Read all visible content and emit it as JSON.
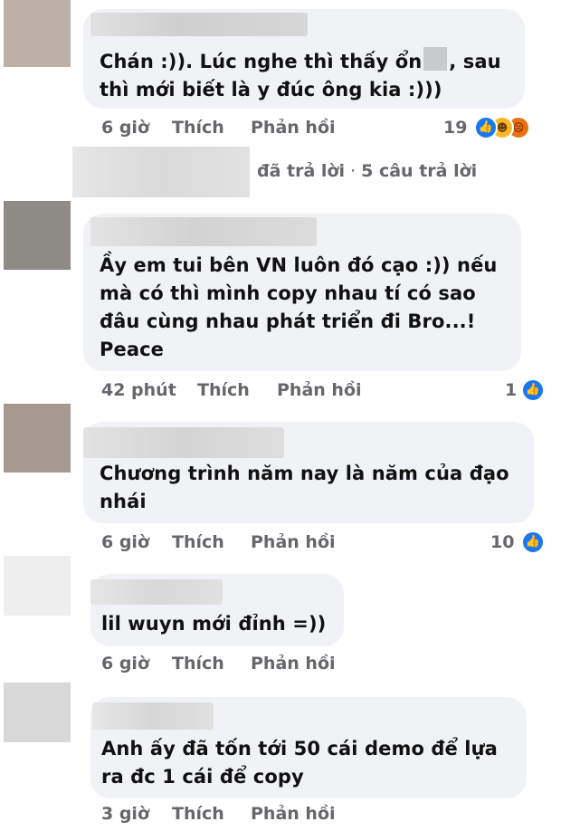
{
  "colors": {
    "bubble": "#f0f2f5",
    "meta_text": "#65676b",
    "like_blue": "#1877f2",
    "haha_yellow": "#f7b928",
    "angry_orange": "#e9710f"
  },
  "comments": [
    {
      "text_before_censor": "Chán :)). Lúc nghe thì thấy ổn",
      "text_after_censor": ", sau\nthì mới biết là y đúc ông kia :)))",
      "time": "6 giờ",
      "like": "Thích",
      "reply": "Phản hồi",
      "reaction_count": "19",
      "reaction_icons": [
        "like-icon",
        "haha-icon",
        "angry-icon"
      ]
    },
    {
      "text": "Ầy em tui bên VN luôn đó cạo :)) nếu\nmà có  thì mình copy nhau tí có sao\nđâu cùng nhau phát triển đi Bro...!\nPeace",
      "time": "42 phút",
      "like": "Thích",
      "reply": "Phản hồi",
      "reaction_count": "1",
      "reaction_icons": [
        "like-icon"
      ]
    },
    {
      "text": "Chương trình năm nay là năm của đạo\nnhái",
      "time": "6 giờ",
      "like": "Thích",
      "reply": "Phản hồi",
      "reaction_count": "10",
      "reaction_icons": [
        "like-icon"
      ]
    },
    {
      "text": "lil wuyn mới đỉnh =))",
      "time": "6 giờ",
      "like": "Thích",
      "reply": "Phản hồi"
    },
    {
      "text": "Anh ấy đã tốn  tới 50 cái demo để lựa\nra đc 1 cái để copy",
      "time": "3 giờ",
      "like": "Thích",
      "reply": "Phản hồi"
    }
  ],
  "replies_summary": {
    "action": "đã trả lời",
    "separator": " · ",
    "count": "5 câu trả lời"
  }
}
